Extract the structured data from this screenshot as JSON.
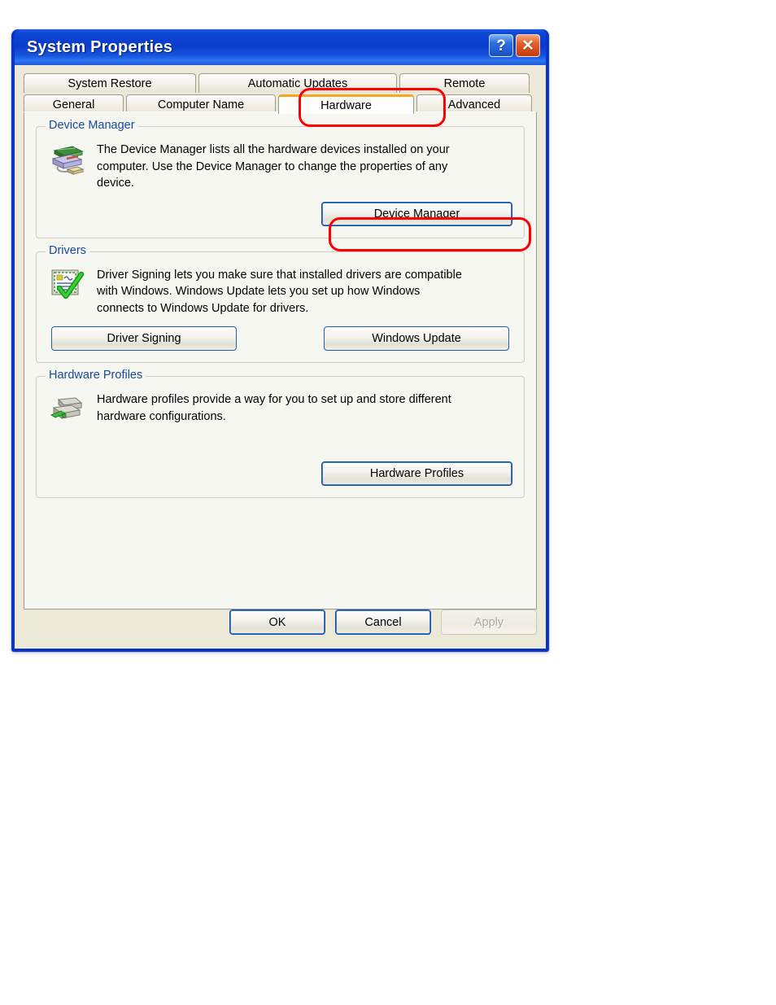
{
  "window": {
    "title": "System Properties",
    "help_button": "?",
    "close_button": "✕"
  },
  "tabs": {
    "row_top": [
      {
        "label": "System Restore",
        "selected": false
      },
      {
        "label": "Automatic Updates",
        "selected": false
      },
      {
        "label": "Remote",
        "selected": false
      }
    ],
    "row_bottom": [
      {
        "label": "General",
        "selected": false
      },
      {
        "label": "Computer Name",
        "selected": false
      },
      {
        "label": "Hardware",
        "selected": true
      },
      {
        "label": "Advanced",
        "selected": false
      }
    ],
    "selected_tab": "Hardware"
  },
  "groups": {
    "device_manager": {
      "legend": "Device Manager",
      "icon": "device-manager-icon",
      "description": "The Device Manager lists all the hardware devices installed on your computer. Use the Device Manager to change the properties of any device.",
      "button": "Device Manager"
    },
    "drivers": {
      "legend": "Drivers",
      "icon": "driver-signing-certificate-icon",
      "description": "Driver Signing lets you make sure that installed drivers are compatible with Windows. Windows Update lets you set up how Windows connects to Windows Update for drivers.",
      "button_driver_signing": "Driver Signing",
      "button_windows_update": "Windows Update"
    },
    "hardware_profiles": {
      "legend": "Hardware Profiles",
      "icon": "hardware-profile-icon",
      "description": "Hardware profiles provide a way for you to set up and store different hardware configurations.",
      "button": "Hardware Profiles"
    }
  },
  "footer": {
    "ok": "OK",
    "cancel": "Cancel",
    "apply": "Apply",
    "apply_disabled": true
  },
  "annotations": {
    "hardware_tab_highlight": "red-rounded-rectangle",
    "device_manager_button_highlight": "red-rounded-rectangle"
  },
  "colors": {
    "titlebar_blue": "#0A3CCB",
    "dialog_face": "#ECE9D8",
    "tab_panel": "#F7F7F2",
    "legend_text": "#15499B",
    "selected_tab_accent": "#F5A623",
    "annotation_red": "#FF0000",
    "button_border_blue": "#1C5FB0"
  }
}
